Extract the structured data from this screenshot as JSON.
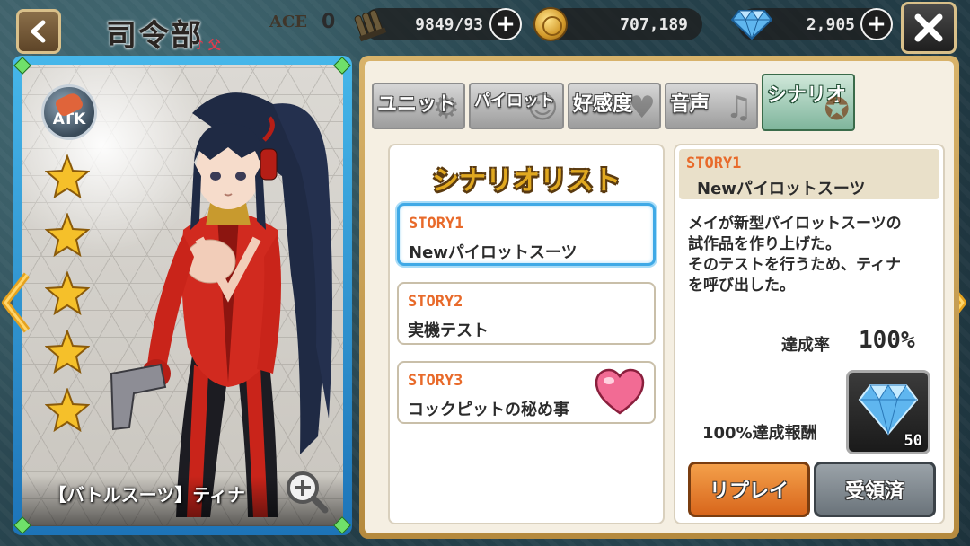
{
  "header": {
    "title": "司令部",
    "title_deco": "♪ 父",
    "ace_label": "ACE",
    "ace_value": "0",
    "ammo": "9849/93",
    "coins": "707,189",
    "gems": "2,905",
    "plus_symbol": "+"
  },
  "card": {
    "type_badge": "ATK",
    "stars": 5,
    "name": "【バトルスーツ】ティナ",
    "colors": {
      "frame": "#2f95d6",
      "suit": "#d12a1f"
    }
  },
  "tabs": [
    {
      "label": "ユニット",
      "active": false
    },
    {
      "label": "パイロット",
      "active": false
    },
    {
      "label": "好感度",
      "active": false
    },
    {
      "label": "音声",
      "active": false
    },
    {
      "label": "シナリオ",
      "active": true
    }
  ],
  "scenario_list": {
    "title": "シナリオリスト",
    "stories": [
      {
        "number": "STORY1",
        "name": "Newパイロットスーツ",
        "selected": true
      },
      {
        "number": "STORY2",
        "name": "実機テスト",
        "selected": false
      },
      {
        "number": "STORY3",
        "name": "コックピットの秘め事",
        "selected": false,
        "icon": "heart-icon"
      }
    ]
  },
  "detail": {
    "number": "STORY1",
    "name": "Newパイロットスーツ",
    "description": [
      "メイが新型パイロットスーツの",
      "試作品を作り上げた。",
      "そのテストを行うため、ティナ",
      "を呼び出した。"
    ],
    "rate_label": "達成率",
    "rate_value": "100%",
    "reward_label": "100%達成報酬",
    "reward_count": "50",
    "reward_icon": "diamond-icon",
    "replay_button": "リプレイ",
    "claimed_button": "受領済"
  }
}
